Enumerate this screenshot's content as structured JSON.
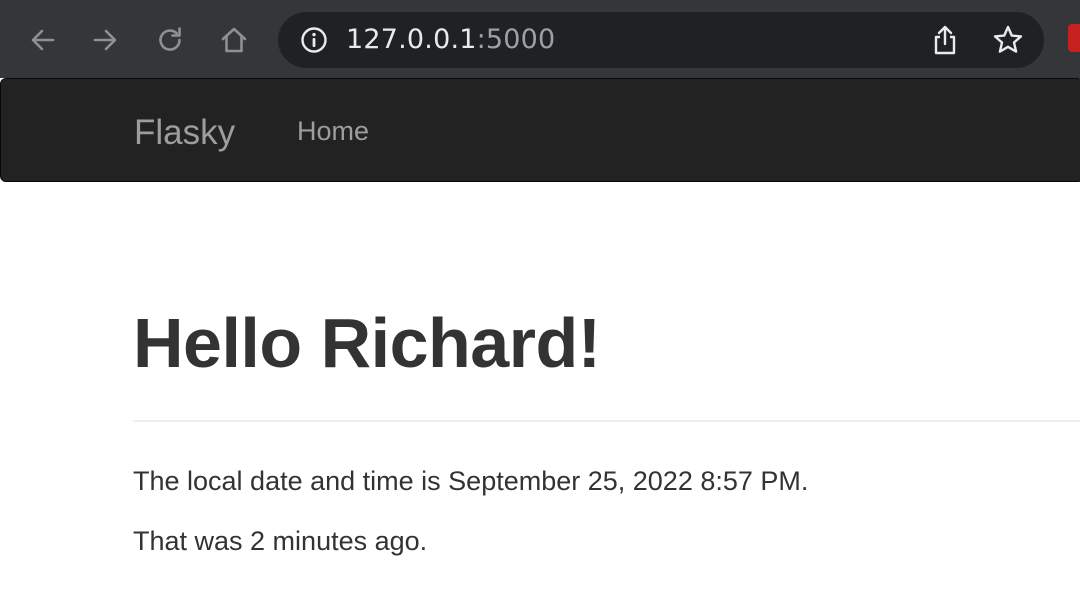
{
  "browser": {
    "url_host": "127.0.0.1",
    "url_port": ":5000",
    "icons": [
      "back-arrow-icon",
      "forward-arrow-icon",
      "reload-icon",
      "home-icon",
      "info-icon",
      "share-icon",
      "star-icon",
      "extension-icon"
    ]
  },
  "navbar": {
    "brand": "Flasky",
    "links": [
      {
        "label": "Home"
      }
    ]
  },
  "main": {
    "heading": "Hello Richard!",
    "local_time_text": "The local date and time is September 25, 2022 8:57 PM.",
    "relative_time_text": "That was 2 minutes ago."
  },
  "colors": {
    "chrome_toolbar": "#35363a",
    "omnibox": "#202124",
    "navbar_bg": "#222222",
    "navbar_text": "#9d9d9d",
    "body_text": "#333333"
  }
}
